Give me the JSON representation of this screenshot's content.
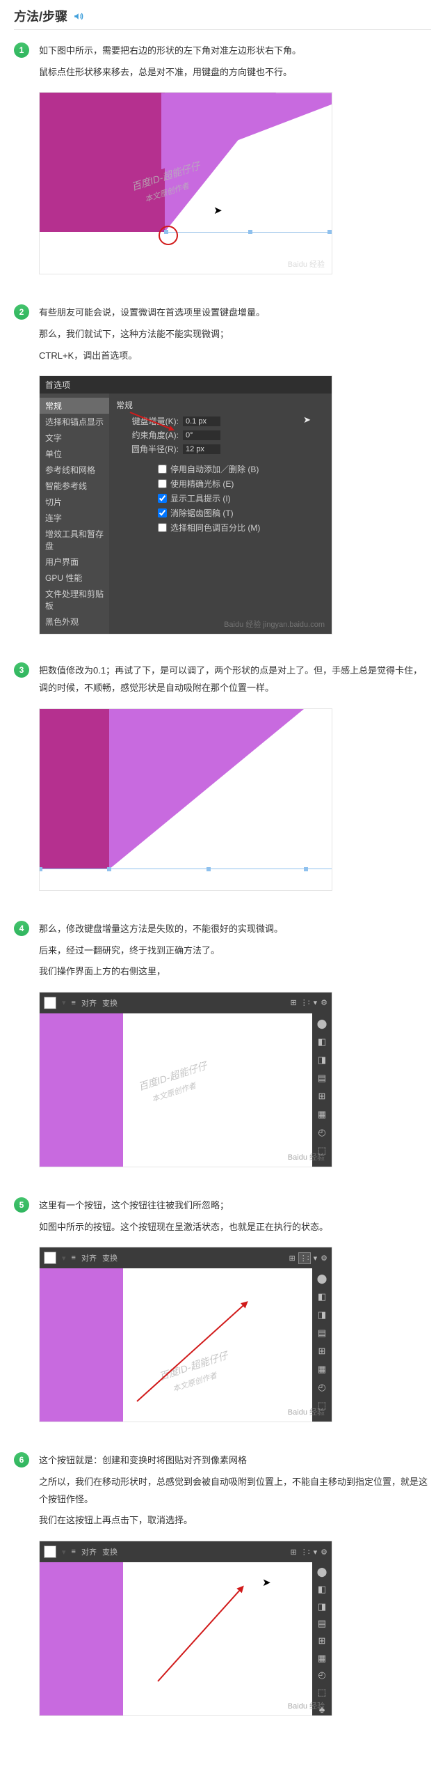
{
  "title": "方法/步骤",
  "icons": {
    "sound": "audio-icon"
  },
  "steps": [
    {
      "num": "1",
      "lines": [
        "如下图中所示，需要把右边的形状的左下角对准左边形状右下角。",
        "鼠标点住形状移来移去，总是对不准，用键盘的方向键也不行。"
      ],
      "wm_text": "百度ID-超能仔仔",
      "wm_sub": "本文原创作者",
      "corner": "Baidu 经验"
    },
    {
      "num": "2",
      "lines": [
        "有些朋友可能会说，设置微调在首选项里设置键盘增量。",
        "那么，我们就试下，这种方法能不能实现微调；",
        "CTRL+K，调出首选项。"
      ],
      "dialog": {
        "title": "首选项",
        "sidebar": [
          "常规",
          "选择和锚点显示",
          "文字",
          "单位",
          "参考线和网格",
          "智能参考线",
          "切片",
          "连字",
          "增效工具和暂存盘",
          "用户界面",
          "GPU 性能",
          "文件处理和剪贴板",
          "黑色外观"
        ],
        "heading": "常规",
        "fields": [
          {
            "label": "键盘增量(K):",
            "value": "0.1 px"
          },
          {
            "label": "约束角度(A):",
            "value": "0°"
          },
          {
            "label": "圆角半径(R):",
            "value": "12 px"
          }
        ],
        "checks": [
          {
            "label": "停用自动添加／删除 (B)",
            "checked": false
          },
          {
            "label": "使用精确光标 (E)",
            "checked": false
          },
          {
            "label": "显示工具提示 (I)",
            "checked": true
          },
          {
            "label": "消除锯齿图稿 (T)",
            "checked": true
          },
          {
            "label": "选择相同色调百分比 (M)",
            "checked": false
          }
        ],
        "corner": "Baidu 经验  jingyan.baidu.com"
      }
    },
    {
      "num": "3",
      "lines": [
        "把数值修改为0.1；再试了下，是可以调了，两个形状的点是对上了。但，手感上总是觉得卡住，调的时候，不顺畅，感觉形状是自动吸附在那个位置一样。"
      ]
    },
    {
      "num": "4",
      "lines": [
        "那么，修改键盘增量这方法是失败的，不能很好的实现微调。",
        "后来，经过一翻研究，终于找到正确方法了。",
        "我们操作界面上方的右侧这里，"
      ],
      "toolbar": {
        "labels": [
          "对齐",
          "变换"
        ]
      },
      "wm_text": "百度ID-超能仔仔",
      "wm_sub": "本文原创作者",
      "corner": "Baidu 经验"
    },
    {
      "num": "5",
      "lines": [
        "这里有一个按钮，这个按钮往往被我们所忽略；",
        "如图中所示的按钮。这个按钮现在呈激活状态，也就是正在执行的状态。"
      ],
      "toolbar": {
        "labels": [
          "对齐",
          "变换"
        ]
      },
      "wm_text": "百度ID-超能仔仔",
      "wm_sub": "本文原创作者",
      "corner": "Baidu 经验"
    },
    {
      "num": "6",
      "lines": [
        "这个按钮就是：创建和变换时将图贴对齐到像素网格",
        "之所以，我们在移动形状时，总感觉到会被自动吸附到位置上，不能自主移动到指定位置，就是这个按钮作怪。",
        "我们在这按钮上再点击下，取消选择。"
      ],
      "toolbar": {
        "labels": [
          "对齐",
          "变换"
        ]
      },
      "corner": "Baidu 经验"
    }
  ]
}
